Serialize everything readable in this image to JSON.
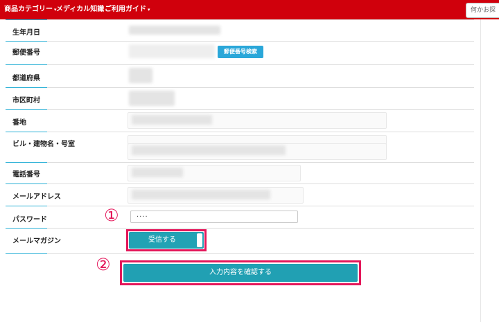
{
  "nav": {
    "items": [
      {
        "label": "商品カテゴリー",
        "caret": "▾"
      },
      {
        "label": "メディカル知識",
        "caret": ""
      },
      {
        "label": "ご利用ガイド",
        "caret": "▾"
      }
    ],
    "search_placeholder": "何かお探"
  },
  "form": {
    "labels": {
      "birth": "生年月日",
      "zip": "郵便番号",
      "pref": "都道府県",
      "city": "市区町村",
      "address": "番地",
      "building": "ビル・建物名・号室",
      "phone": "電話番号",
      "email": "メールアドレス",
      "password": "パスワード",
      "magazine": "メールマガジン"
    },
    "zip_search_button": "郵便番号検索",
    "password_value": "····",
    "magazine_toggle": "受信する",
    "confirm_button": "入力内容を確認する"
  },
  "markers": {
    "one": "①",
    "two": "②"
  },
  "colors": {
    "nav_bg": "#d0000c",
    "accent_blue": "#2ab0d6",
    "teal_button": "#21a0b3",
    "highlight": "#e4175a"
  }
}
